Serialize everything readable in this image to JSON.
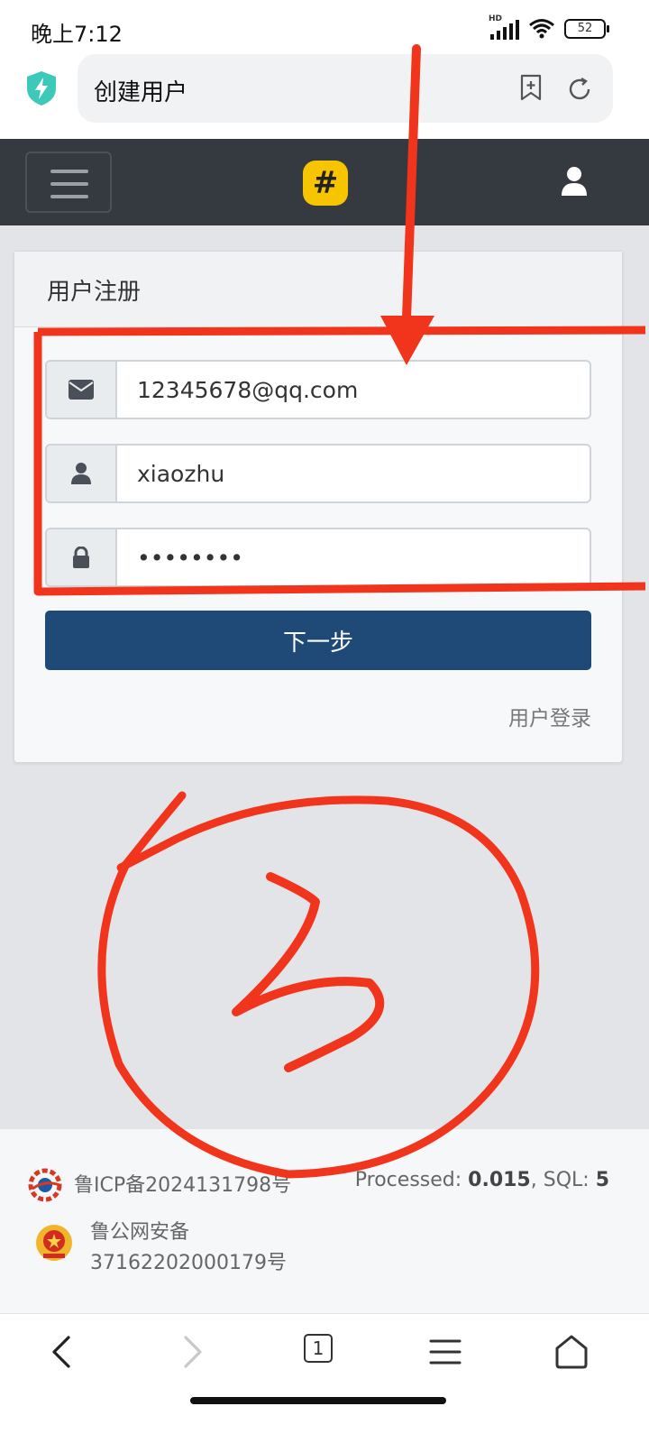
{
  "status_bar": {
    "time": "晚上7:12",
    "battery": "52",
    "network": "HD"
  },
  "browser": {
    "page_title": "创建用户"
  },
  "navbar": {
    "logo_text": "#"
  },
  "card": {
    "header": "用户注册",
    "email_value": "12345678@qq.com",
    "username_value": "xiaozhu",
    "password_value": "12345678",
    "next_button": "下一步",
    "login_link": "用户登录"
  },
  "footer": {
    "icp": "鲁ICP备2024131798号",
    "processed_label": "Processed: ",
    "processed_value": "0.015",
    "sql_label": ", SQL: ",
    "sql_value": "5",
    "police_line1": "鲁公网安备",
    "police_line2": "37162202000179号"
  },
  "bottom_nav": {
    "tab_count": "1"
  },
  "annotation": {
    "color": "#f1341c",
    "handwritten": "3"
  }
}
